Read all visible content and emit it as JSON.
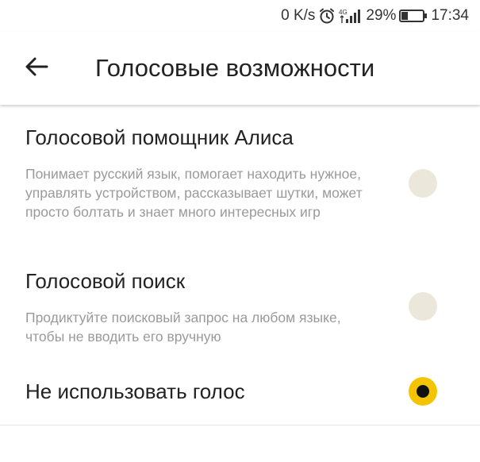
{
  "status_bar": {
    "speed": "0 K/s",
    "alarm_icon": "alarm-icon",
    "signal_icon": "signal-icon",
    "battery_percent": "29%",
    "battery_level": 0.29,
    "time": "17:34"
  },
  "header": {
    "back_icon": "arrow-left-icon",
    "title": "Голосовые возможности"
  },
  "options": [
    {
      "title": "Голосовой помощник Алиса",
      "description": "Понимает русский язык, помогает находить нужное, управлять устройством, рассказывает шутки, может просто болтать и знает много интересных игр",
      "selected": false
    },
    {
      "title": "Голосовой поиск",
      "description": "Продиктуйте поисковый запрос на любом языке, чтобы не вводить его вручную",
      "selected": false
    },
    {
      "title": "Не использовать голос",
      "description": "",
      "selected": true
    }
  ],
  "colors": {
    "accent": "#f5c400",
    "radio_off": "#ebe8db",
    "title_text": "#222222",
    "desc_text": "#9a9a9a"
  }
}
